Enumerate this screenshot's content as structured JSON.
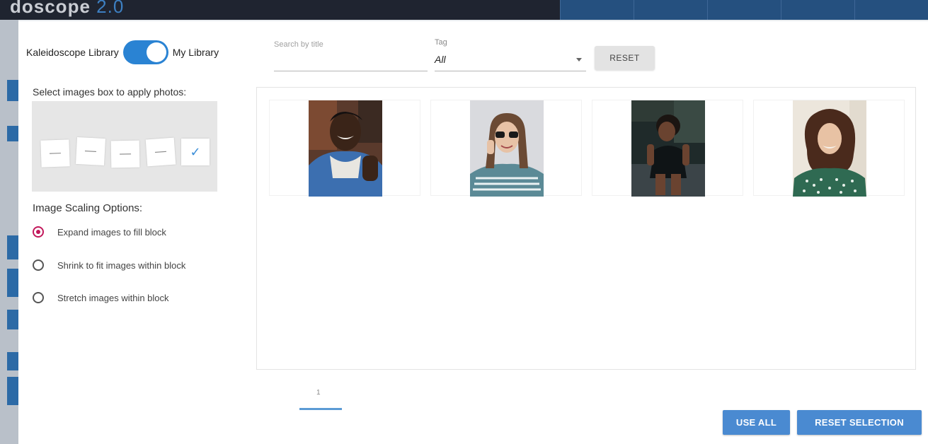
{
  "background_app": {
    "logo_text": "doscope",
    "logo_version": "2.0"
  },
  "library_toggle": {
    "left_label": "Kaleidoscope Library",
    "right_label": "My Library",
    "state": "on"
  },
  "layout_picker": {
    "label": "Select images box to apply photos:",
    "slots": [
      {
        "symbol": "—",
        "checked": false
      },
      {
        "symbol": "—",
        "checked": false
      },
      {
        "symbol": "—",
        "checked": false
      },
      {
        "symbol": "—",
        "checked": false
      },
      {
        "symbol": "✓",
        "checked": true
      }
    ]
  },
  "scaling": {
    "label": "Image Scaling Options:",
    "options": [
      {
        "label": "Expand images to fill block",
        "selected": true
      },
      {
        "label": "Shrink to fit images within block",
        "selected": false
      },
      {
        "label": "Stretch images within block",
        "selected": false
      }
    ]
  },
  "search": {
    "placeholder": "Search by title",
    "value": ""
  },
  "tag": {
    "label": "Tag",
    "value": "All"
  },
  "reset_label": "RESET",
  "photos": [
    {
      "icon": "photo-man-denim-jacket"
    },
    {
      "icon": "photo-woman-sunglasses"
    },
    {
      "icon": "photo-woman-sitting-dark"
    },
    {
      "icon": "photo-woman-curly-hair"
    }
  ],
  "pagination": {
    "current": "1"
  },
  "actions": {
    "use_all": "USE ALL",
    "reset_selection": "RESET SELECTION"
  },
  "colors": {
    "toggle": "#2a83d3",
    "primary_button": "#4a8ad1",
    "radio_selected": "#c2185b"
  }
}
